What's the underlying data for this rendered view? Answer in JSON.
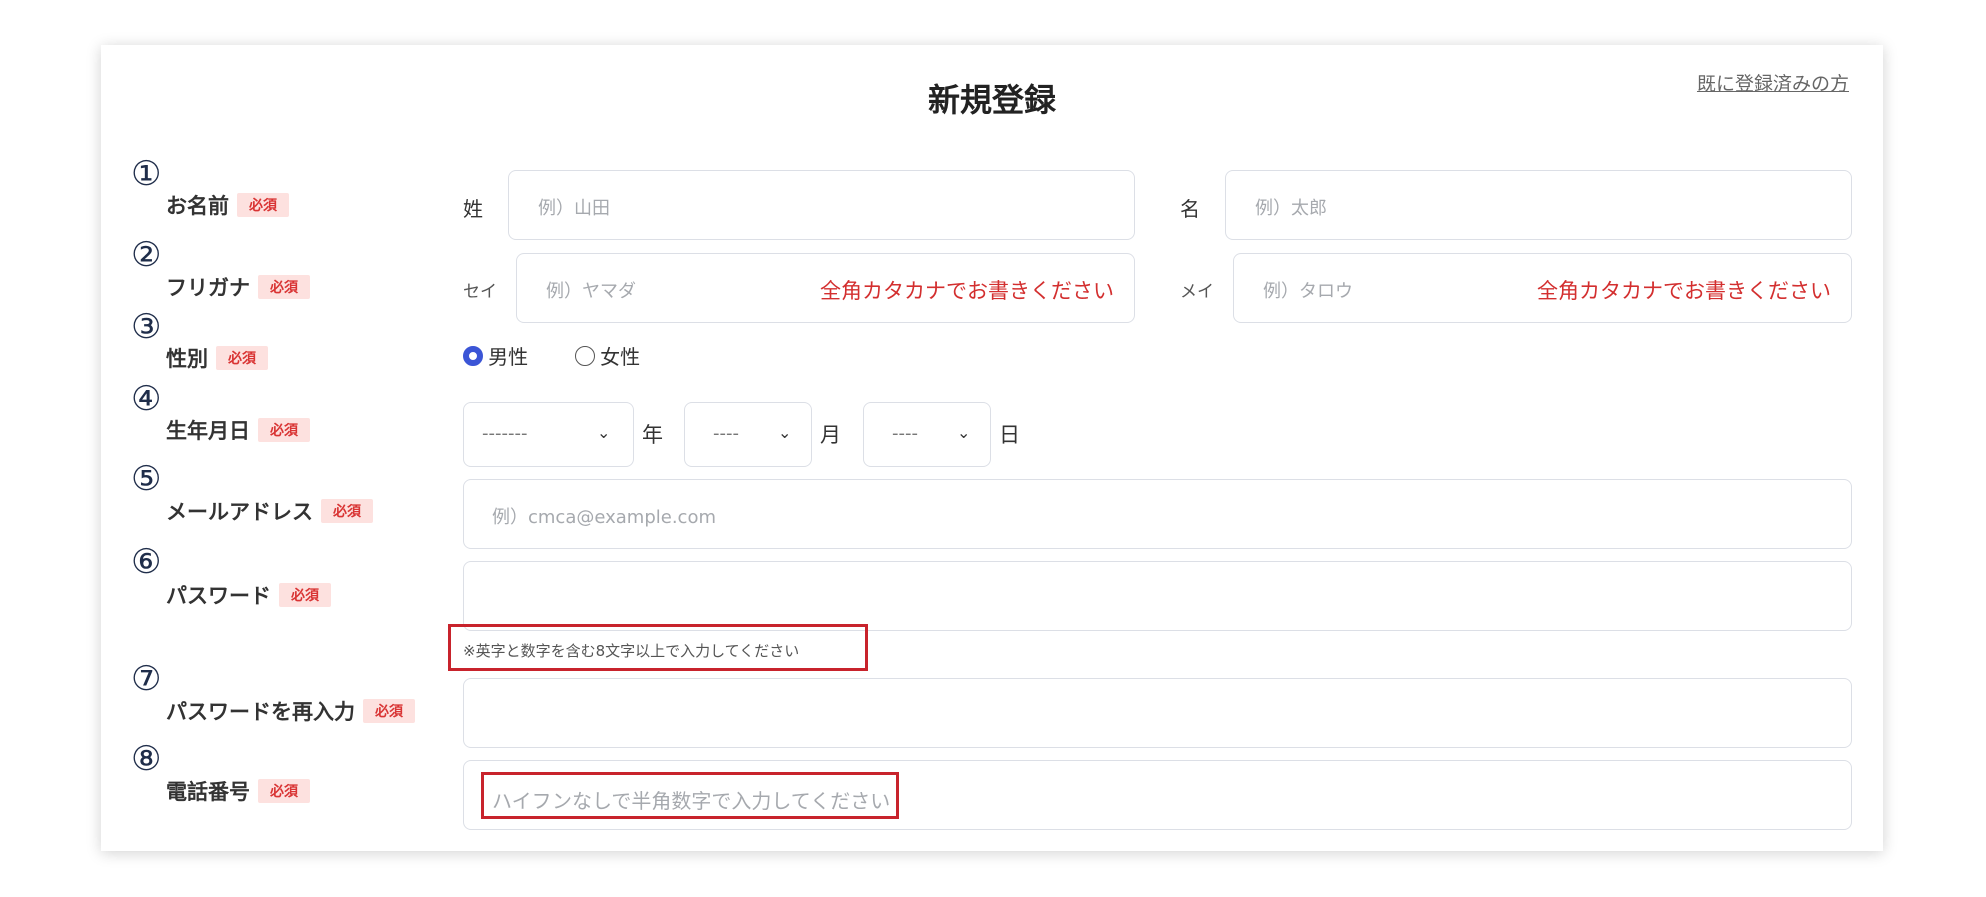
{
  "header": {
    "title": "新規登録",
    "login_link": "既に登録済みの方"
  },
  "required_badge": "必須",
  "rows": {
    "name": {
      "num": "①",
      "label": "お名前",
      "last_label": "姓",
      "last_placeholder": "例）山田",
      "first_label": "名",
      "first_placeholder": "例）太郎"
    },
    "furigana": {
      "num": "②",
      "label": "フリガナ",
      "sei_label": "セイ",
      "sei_placeholder": "例）ヤマダ",
      "sei_hint": "全角カタカナでお書きください",
      "mei_label": "メイ",
      "mei_placeholder": "例）タロウ",
      "mei_hint": "全角カタカナでお書きください"
    },
    "gender": {
      "num": "③",
      "label": "性別",
      "options": [
        "男性",
        "女性"
      ],
      "selected": "男性"
    },
    "birthday": {
      "num": "④",
      "label": "生年月日",
      "year_value": "-------",
      "year_unit": "年",
      "month_value": "----",
      "month_unit": "月",
      "day_value": "----",
      "day_unit": "日"
    },
    "email": {
      "num": "⑤",
      "label": "メールアドレス",
      "placeholder": "例）cmca@example.com"
    },
    "password": {
      "num": "⑥",
      "label": "パスワード",
      "note": "※英字と数字を含む8文字以上で入力してください"
    },
    "password_confirm": {
      "num": "⑦",
      "label": "パスワードを再入力"
    },
    "phone": {
      "num": "⑧",
      "label": "電話番号",
      "placeholder": "ハイフンなしで半角数字で入力してください"
    }
  },
  "colors": {
    "required_bg": "#fde1df",
    "required_text": "#d93434",
    "hint_red": "#d32f2f",
    "radio_accent": "#3b55d6",
    "annotation_box": "#c8232c"
  }
}
